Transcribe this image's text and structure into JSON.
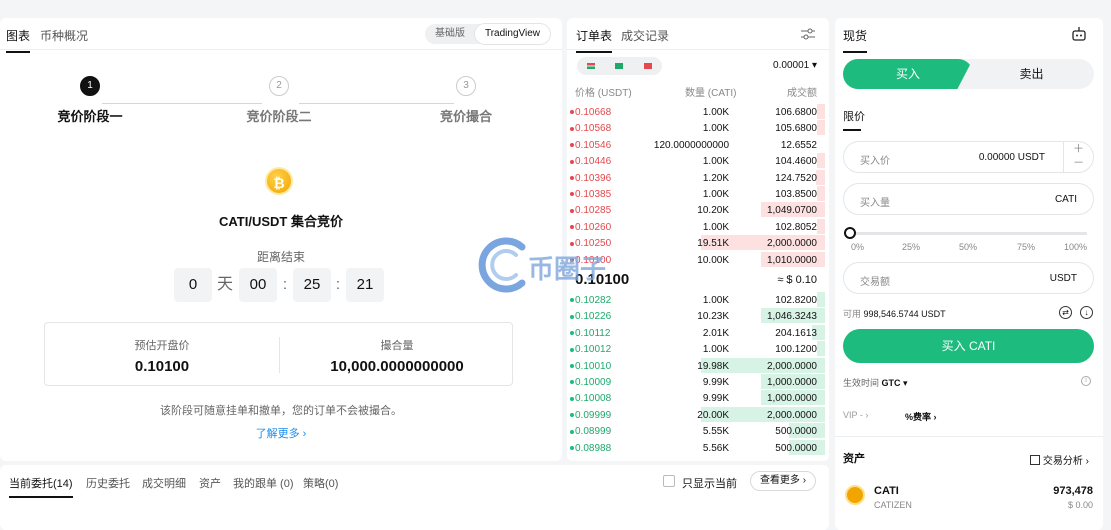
{
  "chart_panel": {
    "tabs": [
      "图表",
      "币种概况"
    ],
    "view_toggle": [
      "基础版",
      "TradingView"
    ],
    "steps": [
      {
        "num": "1",
        "label": "竞价阶段一"
      },
      {
        "num": "2",
        "label": "竞价阶段二"
      },
      {
        "num": "3",
        "label": "竞价撮合"
      }
    ],
    "coin_symbol": "₿",
    "pair_title": "CATI/USDT 集合竞价",
    "countdown_label": "距离结束",
    "countdown": {
      "days": "0",
      "day_unit": "天",
      "hours": "00",
      "minutes": "25",
      "seconds": "21",
      "sep": ":"
    },
    "est_open_label": "预估开盘价",
    "est_open_value": "0.10100",
    "matched_label": "撮合量",
    "matched_value": "10,000.0000000000",
    "note": "该阶段可随意挂单和撤单，您的订单不会被撮合。",
    "learn_more": "了解更多 ›"
  },
  "order_book": {
    "tabs": [
      "订单表",
      "成交记录"
    ],
    "precision": "0.00001 ▾",
    "headers": {
      "price": "价格 (USDT)",
      "qty": "数量 (CATI)",
      "total": "成交额"
    },
    "asks": [
      {
        "price": "0.10668",
        "qty": "1.00K",
        "total": "106.6800",
        "depth": 0.06
      },
      {
        "price": "0.10568",
        "qty": "1.00K",
        "total": "105.6800",
        "depth": 0.06
      },
      {
        "price": "0.10546",
        "qty": "120.0000000000",
        "total": "12.6552",
        "depth": 0.0
      },
      {
        "price": "0.10446",
        "qty": "1.00K",
        "total": "104.4600",
        "depth": 0.06
      },
      {
        "price": "0.10396",
        "qty": "1.20K",
        "total": "124.7520",
        "depth": 0.07
      },
      {
        "price": "0.10385",
        "qty": "1.00K",
        "total": "103.8500",
        "depth": 0.06
      },
      {
        "price": "0.10285",
        "qty": "10.20K",
        "total": "1,049.0700",
        "depth": 0.5
      },
      {
        "price": "0.10260",
        "qty": "1.00K",
        "total": "102.8052",
        "depth": 0.06
      },
      {
        "price": "0.10250",
        "qty": "19.51K",
        "total": "2,000.0000",
        "depth": 0.97
      },
      {
        "price": "0.10100",
        "qty": "10.00K",
        "total": "1,010.0000",
        "depth": 0.5
      }
    ],
    "mid_price": "0.10100",
    "mid_usd": "≈ $ 0.10",
    "bids": [
      {
        "price": "0.10282",
        "qty": "1.00K",
        "total": "102.8200",
        "depth": 0.06
      },
      {
        "price": "0.10226",
        "qty": "10.23K",
        "total": "1,046.3243",
        "depth": 0.5
      },
      {
        "price": "0.10112",
        "qty": "2.01K",
        "total": "204.1613",
        "depth": 0.1
      },
      {
        "price": "0.10012",
        "qty": "1.00K",
        "total": "100.1200",
        "depth": 0.06
      },
      {
        "price": "0.10010",
        "qty": "19.98K",
        "total": "2,000.0000",
        "depth": 0.97
      },
      {
        "price": "0.10009",
        "qty": "9.99K",
        "total": "1,000.0000",
        "depth": 0.5
      },
      {
        "price": "0.10008",
        "qty": "9.99K",
        "total": "1,000.0000",
        "depth": 0.5
      },
      {
        "price": "0.09999",
        "qty": "20.00K",
        "total": "2,000.0000",
        "depth": 0.97
      },
      {
        "price": "0.08999",
        "qty": "5.55K",
        "total": "500.0000",
        "depth": 0.28
      },
      {
        "price": "0.08988",
        "qty": "5.56K",
        "total": "500.0000",
        "depth": 0.28
      }
    ]
  },
  "trade_panel": {
    "tab": "现货",
    "buy_tab": "买入",
    "sell_tab": "卖出",
    "order_type": "限价",
    "price_label": "买入价",
    "price_value": "0.00000 USDT",
    "amount_label": "买入量",
    "amount_unit": "CATI",
    "percent_marks": [
      "0%",
      "25%",
      "50%",
      "75%",
      "100%"
    ],
    "slider_level": 0,
    "total_label": "交易额",
    "total_unit": "USDT",
    "avail_label": "可用",
    "avail_value": "998,546.5744 USDT",
    "buy_button": "买入 CATI",
    "tif_label": "生效时间",
    "tif_value": "GTC ▾",
    "vip_label": "VIP - ›",
    "fee_label": "%费率 ›",
    "assets_title": "资产",
    "analysis_label": "交易分析 ›",
    "asset": {
      "name": "CATI",
      "sub": "CATIZEN",
      "amount": "973,478",
      "usd": "$ 0.00"
    }
  },
  "orders_panel": {
    "tabs": [
      "当前委托(14)",
      "历史委托",
      "成交明细",
      "资产",
      "我的跟单 (0)",
      "策略(0)"
    ],
    "only_current": "只显示当前",
    "view_more": "查看更多 ›"
  },
  "watermark": {
    "text": "币圈子"
  },
  "colors": {
    "green": "#1dbb7e",
    "red": "#e5484d",
    "link": "#1a8df0"
  }
}
